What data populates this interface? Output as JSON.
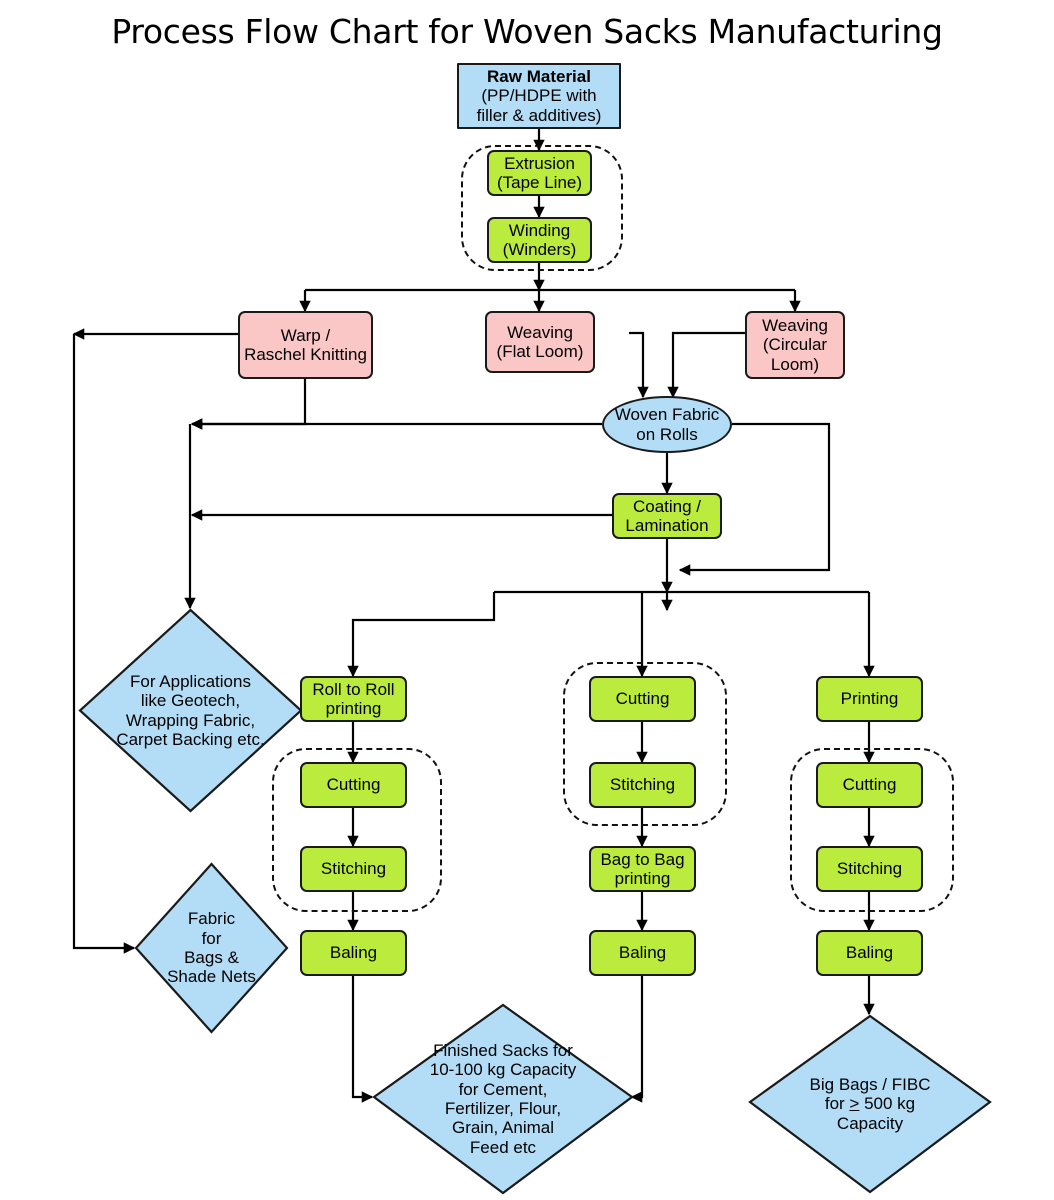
{
  "title": "Process Flow Chart for Woven Sacks Manufacturing",
  "colors": {
    "blue": "#b3ddf6",
    "green": "#bbeb3c",
    "pink": "#fbc6c6",
    "stroke": "#1a1a1a",
    "background": "#ffffff"
  },
  "chart_data": {
    "type": "diagram",
    "title": "Process Flow Chart for Woven Sacks Manufacturing",
    "nodes": [
      {
        "id": "raw_material",
        "label": "Raw Material\n(PP/HDPE with\nfiller & additives)",
        "shape": "rect",
        "color": "blue"
      },
      {
        "id": "extrusion",
        "label": "Extrusion\n(Tape Line)",
        "shape": "rect",
        "color": "green"
      },
      {
        "id": "winding",
        "label": "Winding\n(Winders)",
        "shape": "rect",
        "color": "green"
      },
      {
        "id": "warp_knitting",
        "label": "Warp /\nRaschel Knitting",
        "shape": "rect",
        "color": "pink"
      },
      {
        "id": "weaving_flat",
        "label": "Weaving\n(Flat Loom)",
        "shape": "rect",
        "color": "pink"
      },
      {
        "id": "weaving_circ",
        "label": "Weaving\n(Circular\nLoom)",
        "shape": "rect",
        "color": "pink"
      },
      {
        "id": "woven_fabric",
        "label": "Woven Fabric\non Rolls",
        "shape": "ellipse",
        "color": "blue"
      },
      {
        "id": "coating",
        "label": "Coating /\nLamination",
        "shape": "rect",
        "color": "green"
      },
      {
        "id": "app_geotech",
        "label": "For Applications\nlike Geotech,\nWrapping Fabric,\nCarpet Backing etc.",
        "shape": "diamond",
        "color": "blue"
      },
      {
        "id": "fabric_bags",
        "label": "Fabric\nfor\nBags &\nShade Nets",
        "shape": "diamond",
        "color": "blue"
      },
      {
        "id": "roll_printing",
        "label": "Roll to Roll\nprinting",
        "shape": "rect",
        "color": "green"
      },
      {
        "id": "cutting_a",
        "label": "Cutting",
        "shape": "rect",
        "color": "green"
      },
      {
        "id": "stitching_a",
        "label": "Stitching",
        "shape": "rect",
        "color": "green"
      },
      {
        "id": "baling_a",
        "label": "Baling",
        "shape": "rect",
        "color": "green"
      },
      {
        "id": "cutting_b",
        "label": "Cutting",
        "shape": "rect",
        "color": "green"
      },
      {
        "id": "stitching_b",
        "label": "Stitching",
        "shape": "rect",
        "color": "green"
      },
      {
        "id": "bag_printing",
        "label": "Bag to Bag\nprinting",
        "shape": "rect",
        "color": "green"
      },
      {
        "id": "baling_b",
        "label": "Baling",
        "shape": "rect",
        "color": "green"
      },
      {
        "id": "printing_c",
        "label": "Printing",
        "shape": "rect",
        "color": "green"
      },
      {
        "id": "cutting_c",
        "label": "Cutting",
        "shape": "rect",
        "color": "green"
      },
      {
        "id": "stitching_c",
        "label": "Stitching",
        "shape": "rect",
        "color": "green"
      },
      {
        "id": "baling_c",
        "label": "Baling",
        "shape": "rect",
        "color": "green"
      },
      {
        "id": "finished_sacks",
        "label": "Finished Sacks for\n10-100 kg Capacity\nfor Cement,\nFertilizer, Flour,\nGrain, Animal\nFeed etc",
        "shape": "diamond",
        "color": "blue"
      },
      {
        "id": "big_bags",
        "label": "Big Bags / FIBC\nfor ≥ 500 kg\nCapacity",
        "shape": "diamond",
        "color": "blue"
      }
    ],
    "edges": [
      {
        "from": "raw_material",
        "to": "extrusion"
      },
      {
        "from": "extrusion",
        "to": "winding"
      },
      {
        "from": "winding",
        "to": "warp_knitting"
      },
      {
        "from": "winding",
        "to": "weaving_flat"
      },
      {
        "from": "winding",
        "to": "weaving_circ"
      },
      {
        "from": "weaving_flat",
        "to": "woven_fabric"
      },
      {
        "from": "weaving_circ",
        "to": "woven_fabric"
      },
      {
        "from": "warp_knitting",
        "to": "fabric_bags"
      },
      {
        "from": "warp_knitting",
        "to": "app_geotech"
      },
      {
        "from": "woven_fabric",
        "to": "coating"
      },
      {
        "from": "woven_fabric",
        "to": "app_geotech"
      },
      {
        "from": "woven_fabric",
        "to": "converting"
      },
      {
        "from": "coating",
        "to": "app_geotech"
      },
      {
        "from": "coating",
        "to": "roll_printing"
      },
      {
        "from": "coating",
        "to": "cutting_b"
      },
      {
        "from": "coating",
        "to": "printing_c"
      },
      {
        "from": "roll_printing",
        "to": "cutting_a"
      },
      {
        "from": "cutting_a",
        "to": "stitching_a"
      },
      {
        "from": "stitching_a",
        "to": "baling_a"
      },
      {
        "from": "baling_a",
        "to": "finished_sacks"
      },
      {
        "from": "cutting_b",
        "to": "stitching_b"
      },
      {
        "from": "stitching_b",
        "to": "bag_printing"
      },
      {
        "from": "bag_printing",
        "to": "baling_b"
      },
      {
        "from": "baling_b",
        "to": "finished_sacks"
      },
      {
        "from": "printing_c",
        "to": "cutting_c"
      },
      {
        "from": "cutting_c",
        "to": "stitching_c"
      },
      {
        "from": "stitching_c",
        "to": "baling_c"
      },
      {
        "from": "baling_c",
        "to": "big_bags"
      }
    ],
    "groups": [
      {
        "id": "group_tape_line",
        "members": [
          "extrusion",
          "winding"
        ]
      },
      {
        "id": "group_convert_a",
        "members": [
          "cutting_a",
          "stitching_a"
        ]
      },
      {
        "id": "group_convert_b",
        "members": [
          "cutting_b",
          "stitching_b"
        ]
      },
      {
        "id": "group_convert_c",
        "members": [
          "cutting_c",
          "stitching_c"
        ]
      }
    ]
  },
  "nodes": {
    "raw_material": {
      "line1": "Raw Material",
      "line2": "(PP/HDPE with",
      "line3": "filler & additives)"
    },
    "extrusion": {
      "line1": "Extrusion",
      "line2": "(Tape Line)"
    },
    "winding": {
      "line1": "Winding",
      "line2": "(Winders)"
    },
    "warp_knitting": {
      "line1": "Warp /",
      "line2": "Raschel Knitting"
    },
    "weaving_flat": {
      "line1": "Weaving",
      "line2": "(Flat Loom)"
    },
    "weaving_circ": {
      "line1": "Weaving",
      "line2": "(Circular",
      "line3": "Loom)"
    },
    "woven_fabric": {
      "line1": "Woven Fabric",
      "line2": "on Rolls"
    },
    "coating": {
      "line1": "Coating /",
      "line2": "Lamination"
    },
    "app_geotech": {
      "line1": "For Applications",
      "line2": "like Geotech,",
      "line3": "Wrapping Fabric,",
      "line4": "Carpet Backing etc."
    },
    "fabric_bags": {
      "line1": "Fabric",
      "line2": "for",
      "line3": "Bags &",
      "line4": "Shade Nets"
    },
    "roll_printing": {
      "line1": "Roll to Roll",
      "line2": "printing"
    },
    "cutting_a": {
      "line1": "Cutting"
    },
    "stitching_a": {
      "line1": "Stitching"
    },
    "baling_a": {
      "line1": "Baling"
    },
    "cutting_b": {
      "line1": "Cutting"
    },
    "stitching_b": {
      "line1": "Stitching"
    },
    "bag_printing": {
      "line1": "Bag to Bag",
      "line2": "printing"
    },
    "baling_b": {
      "line1": "Baling"
    },
    "printing_c": {
      "line1": "Printing"
    },
    "cutting_c": {
      "line1": "Cutting"
    },
    "stitching_c": {
      "line1": "Stitching"
    },
    "baling_c": {
      "line1": "Baling"
    },
    "finished_sacks": {
      "line1": "Finished Sacks for",
      "line2": "10-100 kg Capacity",
      "line3": "for Cement,",
      "line4": "Fertilizer, Flour,",
      "line5": "Grain, Animal",
      "line6": "Feed etc"
    },
    "big_bags": {
      "line1": "Big Bags / FIBC",
      "line2a": "for ",
      "line2b": ">",
      "line2c": " 500 kg",
      "line3": "Capacity"
    }
  }
}
